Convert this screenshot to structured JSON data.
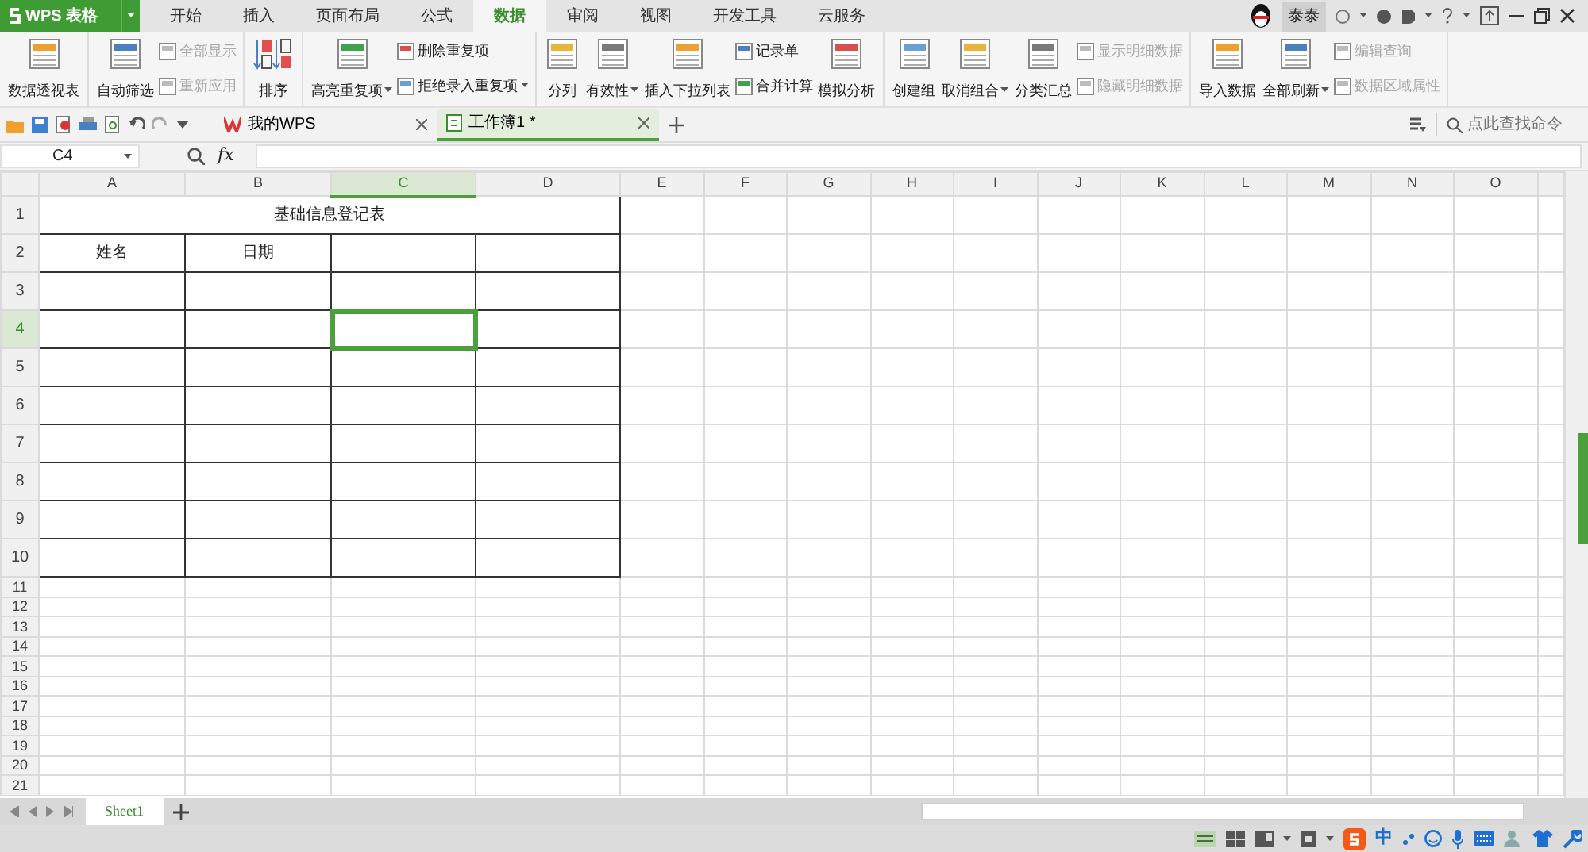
{
  "app_button": {
    "label": "WPS 表格"
  },
  "menu_tabs": [
    {
      "label": "开始",
      "selected": false
    },
    {
      "label": "插入",
      "selected": false
    },
    {
      "label": "页面布局",
      "selected": false
    },
    {
      "label": "公式",
      "selected": false
    },
    {
      "label": "数据",
      "selected": true
    },
    {
      "label": "审阅",
      "selected": false
    },
    {
      "label": "视图",
      "selected": false
    },
    {
      "label": "开发工具",
      "selected": false
    },
    {
      "label": "云服务",
      "selected": false
    }
  ],
  "user": {
    "name": "泰泰"
  },
  "ribbon_groups": [
    {
      "columns": [
        {
          "kind": "large",
          "label": "数据透视表",
          "disabled": false
        }
      ]
    },
    {
      "columns": [
        {
          "kind": "large",
          "label": "自动筛选",
          "disabled": false
        },
        {
          "kind": "stack",
          "items": [
            {
              "label": "全部显示",
              "disabled": true
            },
            {
              "label": "重新应用",
              "disabled": true
            }
          ]
        }
      ]
    },
    {
      "columns": [
        {
          "kind": "sort",
          "label": "排序",
          "disabled": false
        }
      ]
    },
    {
      "columns": [
        {
          "kind": "large",
          "label": "高亮重复项",
          "disabled": false,
          "dropdown": true
        },
        {
          "kind": "stack",
          "items": [
            {
              "label": "删除重复项",
              "disabled": false
            },
            {
              "label": "拒绝录入重复项",
              "disabled": false,
              "dropdown": true
            }
          ]
        }
      ]
    },
    {
      "columns": [
        {
          "kind": "large",
          "label": "分列",
          "disabled": false
        },
        {
          "kind": "large",
          "label": "有效性",
          "disabled": false,
          "dropdown": true
        },
        {
          "kind": "large",
          "label": "插入下拉列表",
          "disabled": false
        },
        {
          "kind": "stack",
          "items": [
            {
              "label": "记录单",
              "disabled": false
            },
            {
              "label": "合并计算",
              "disabled": false
            }
          ]
        },
        {
          "kind": "large",
          "label": "模拟分析",
          "disabled": false
        }
      ]
    },
    {
      "columns": [
        {
          "kind": "large",
          "label": "创建组",
          "disabled": false
        },
        {
          "kind": "large",
          "label": "取消组合",
          "disabled": false,
          "dropdown": true
        },
        {
          "kind": "large",
          "label": "分类汇总",
          "disabled": false
        },
        {
          "kind": "stack",
          "items": [
            {
              "label": "显示明细数据",
              "disabled": true
            },
            {
              "label": "隐藏明细数据",
              "disabled": true
            }
          ]
        }
      ]
    },
    {
      "columns": [
        {
          "kind": "large",
          "label": "导入数据",
          "disabled": false
        },
        {
          "kind": "large",
          "label": "全部刷新",
          "disabled": false,
          "dropdown": true
        },
        {
          "kind": "stack",
          "items": [
            {
              "label": "编辑查询",
              "disabled": true
            },
            {
              "label": "数据区域属性",
              "disabled": true
            }
          ]
        }
      ]
    }
  ],
  "doc_tabs": [
    {
      "label": "我的WPS",
      "selected": false
    },
    {
      "label": "工作簿1 *",
      "selected": true
    }
  ],
  "command_search": {
    "placeholder": "点此查找命令"
  },
  "formula_bar": {
    "name_box": "C4",
    "fx": "fx"
  },
  "columns": [
    {
      "label": "A",
      "selected": false
    },
    {
      "label": "B",
      "selected": false
    },
    {
      "label": "C",
      "selected": true
    },
    {
      "label": "D",
      "selected": false
    },
    {
      "label": "E",
      "selected": false
    },
    {
      "label": "F",
      "selected": false
    },
    {
      "label": "G",
      "selected": false
    },
    {
      "label": "H",
      "selected": false
    },
    {
      "label": "I",
      "selected": false
    },
    {
      "label": "J",
      "selected": false
    },
    {
      "label": "K",
      "selected": false
    },
    {
      "label": "L",
      "selected": false
    },
    {
      "label": "M",
      "selected": false
    },
    {
      "label": "N",
      "selected": false
    },
    {
      "label": "O",
      "selected": false
    }
  ],
  "rows": [
    {
      "label": "1",
      "selected": false,
      "cells": [
        {
          "text": "基础信息登记表",
          "selected": false
        }
      ]
    },
    {
      "label": "2",
      "selected": false,
      "cells": [
        {
          "text": "姓名",
          "selected": false
        },
        {
          "text": "日期",
          "selected": false
        },
        {
          "selected": false
        },
        {
          "selected": false
        }
      ]
    },
    {
      "label": "3",
      "selected": false,
      "cells": [
        {
          "selected": false
        },
        {
          "selected": false
        },
        {
          "selected": false
        },
        {
          "selected": false
        }
      ]
    },
    {
      "label": "4",
      "selected": true,
      "cells": [
        {
          "selected": false
        },
        {
          "selected": false
        },
        {
          "selected": true
        },
        {
          "selected": false
        }
      ]
    },
    {
      "label": "5",
      "selected": false,
      "cells": [
        {
          "selected": false
        },
        {
          "selected": false
        },
        {
          "selected": false
        },
        {
          "selected": false
        }
      ]
    },
    {
      "label": "6",
      "selected": false,
      "cells": [
        {
          "selected": false
        },
        {
          "selected": false
        },
        {
          "selected": false
        },
        {
          "selected": false
        }
      ]
    },
    {
      "label": "7",
      "selected": false,
      "cells": [
        {
          "selected": false
        },
        {
          "selected": false
        },
        {
          "selected": false
        },
        {
          "selected": false
        }
      ]
    },
    {
      "label": "8",
      "selected": false,
      "cells": [
        {
          "selected": false
        },
        {
          "selected": false
        },
        {
          "selected": false
        },
        {
          "selected": false
        }
      ]
    },
    {
      "label": "9",
      "selected": false,
      "cells": [
        {
          "selected": false
        },
        {
          "selected": false
        },
        {
          "selected": false
        },
        {
          "selected": false
        }
      ]
    },
    {
      "label": "10",
      "selected": false,
      "cells": [
        {
          "selected": false
        },
        {
          "selected": false
        },
        {
          "selected": false
        },
        {
          "selected": false
        }
      ]
    },
    {
      "label": "11",
      "selected": false
    },
    {
      "label": "12",
      "selected": false
    },
    {
      "label": "13",
      "selected": false
    },
    {
      "label": "14",
      "selected": false
    },
    {
      "label": "15",
      "selected": false
    },
    {
      "label": "16",
      "selected": false
    },
    {
      "label": "17",
      "selected": false
    },
    {
      "label": "18",
      "selected": false
    },
    {
      "label": "19",
      "selected": false
    },
    {
      "label": "20",
      "selected": false
    },
    {
      "label": "21",
      "selected": false
    }
  ],
  "sheet_tabs": [
    {
      "label": "Sheet1",
      "selected": true
    }
  ],
  "ime_label": "中"
}
